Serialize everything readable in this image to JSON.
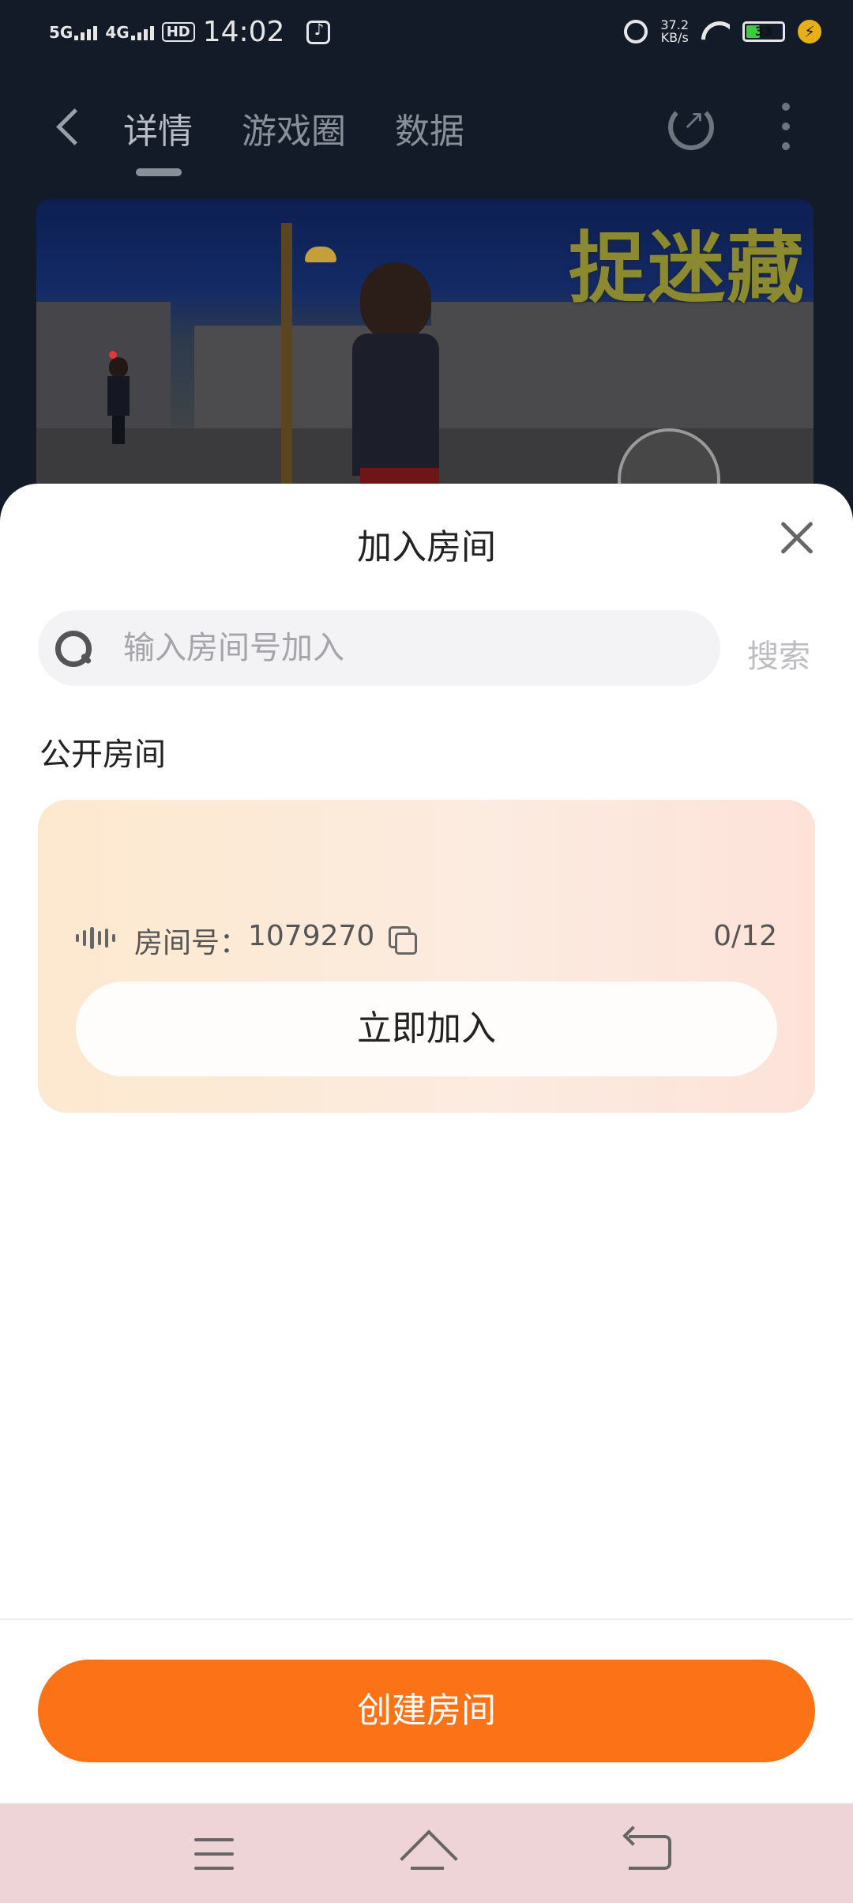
{
  "status_bar": {
    "net1": "5G",
    "net2": "4G",
    "hd": "HD",
    "time": "14:02",
    "speed_value": "37.2",
    "speed_unit": "KB/s",
    "battery": "33"
  },
  "nav": {
    "tabs": [
      "详情",
      "游戏圈",
      "数据"
    ],
    "active_tab": 0
  },
  "banner": {
    "title": "捉迷藏"
  },
  "sheet": {
    "title": "加入房间",
    "search": {
      "placeholder": "输入房间号加入",
      "button": "搜索"
    },
    "section_title": "公开房间",
    "room": {
      "label": "房间号：",
      "number": "1079270",
      "count": "0/12",
      "join_label": "立即加入"
    },
    "create_label": "创建房间"
  },
  "colors": {
    "accent": "#fc7216",
    "card_gradient_start": "#fde9cf",
    "card_gradient_end": "#fde2d8",
    "nav_bar_bg": "#efd4d7"
  },
  "icons": {
    "back": "chevron-left-icon",
    "share": "share-icon",
    "more": "more-vertical-icon",
    "search": "search-icon",
    "close": "close-icon",
    "voice": "voice-wave-icon",
    "copy": "copy-icon"
  }
}
